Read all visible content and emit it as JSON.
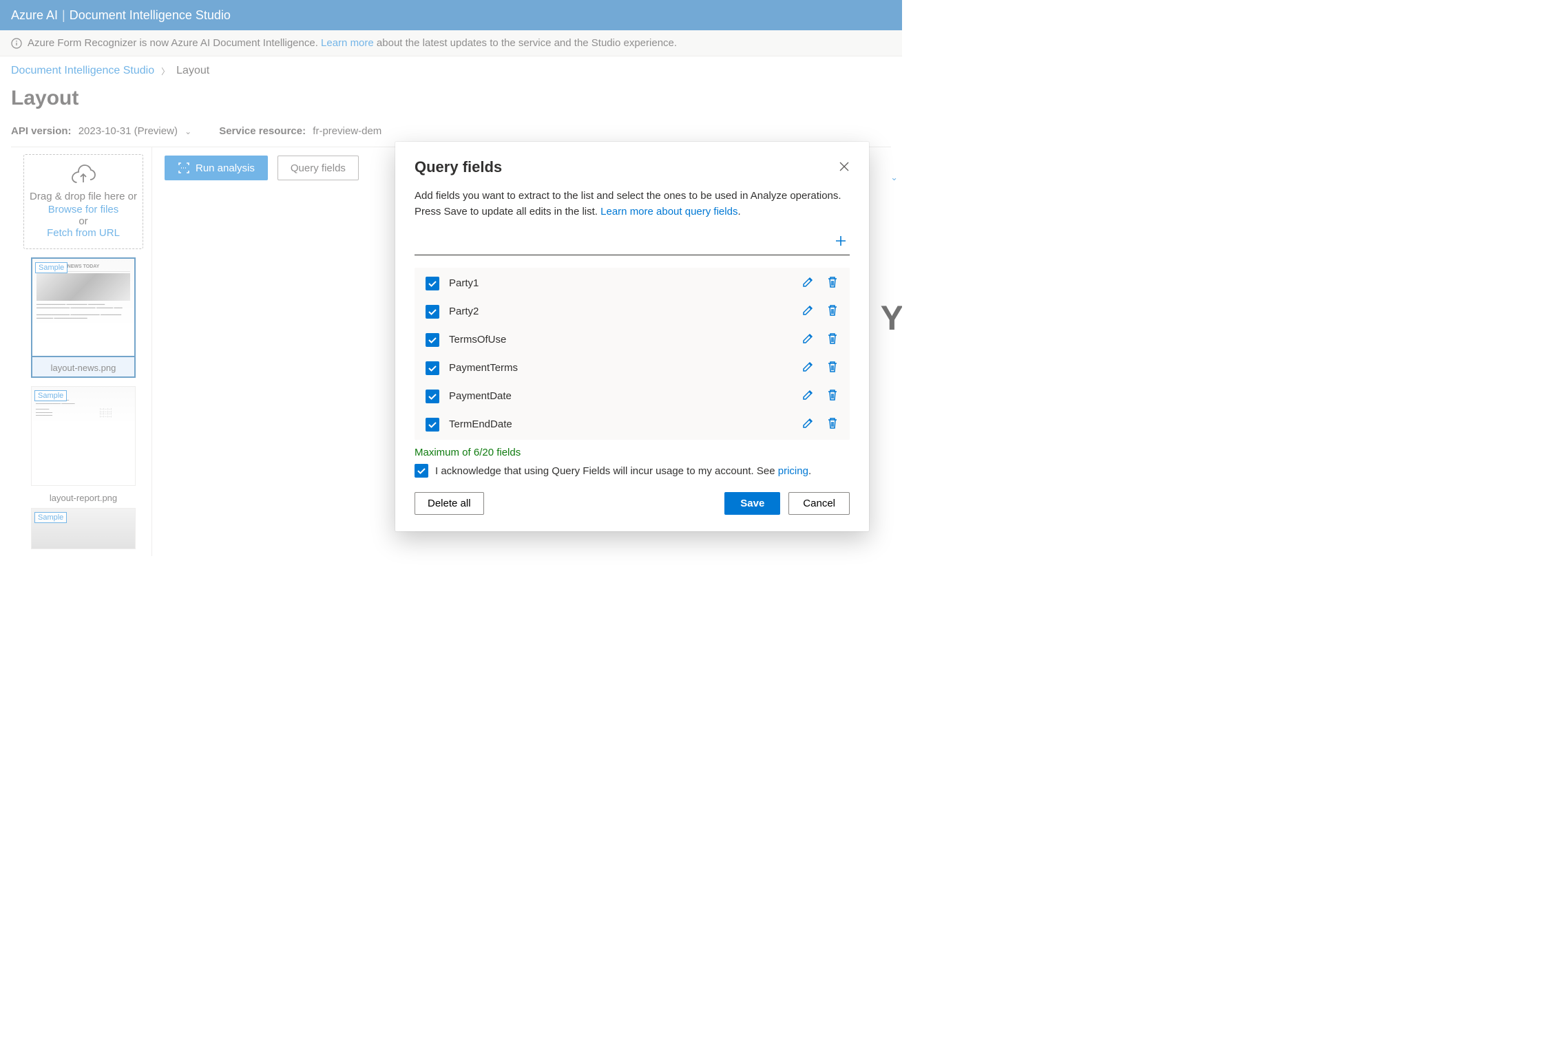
{
  "top_bar": {
    "brand": "Azure AI",
    "product": "Document Intelligence Studio"
  },
  "banner": {
    "text_before": "Azure Form Recognizer is now Azure AI Document Intelligence. ",
    "link": "Learn more",
    "text_after": " about the latest updates to the service and the Studio experience."
  },
  "breadcrumb": {
    "root": "Document Intelligence Studio",
    "current": "Layout"
  },
  "page_title": "Layout",
  "meta": {
    "api_label": "API version:",
    "api_value": "2023-10-31 (Preview)",
    "resource_label": "Service resource:",
    "resource_value": "fr-preview-dem"
  },
  "dropzone": {
    "line1": "Drag & drop file here or",
    "browse": "Browse for files",
    "or": "or",
    "fetch": "Fetch from URL"
  },
  "thumbs": [
    {
      "badge": "Sample",
      "label": "layout-news.png",
      "selected": true,
      "headline": "NEWS TODAY"
    },
    {
      "badge": "Sample",
      "label": "layout-report.png",
      "selected": false,
      "headline": ""
    },
    {
      "badge": "Sample",
      "label": "",
      "selected": false,
      "headline": ""
    }
  ],
  "toolbar": {
    "run": "Run analysis",
    "query": "Query fields"
  },
  "modal": {
    "title": "Query fields",
    "desc": "Add fields you want to extract to the list and select the ones to be used in Analyze operations. Press Save to update all edits in the list. ",
    "learn_link": "Learn more about query fields",
    "fields": [
      {
        "name": "Party1",
        "checked": true
      },
      {
        "name": "Party2",
        "checked": true
      },
      {
        "name": "TermsOfUse",
        "checked": true
      },
      {
        "name": "PaymentTerms",
        "checked": true
      },
      {
        "name": "PaymentDate",
        "checked": true
      },
      {
        "name": "TermEndDate",
        "checked": true
      }
    ],
    "max_msg": "Maximum of 6/20 fields",
    "ack_text": "I acknowledge that using Query Fields will incur usage to my account. See ",
    "ack_link": "pricing",
    "delete_all": "Delete all",
    "save": "Save",
    "cancel": "Cancel"
  }
}
